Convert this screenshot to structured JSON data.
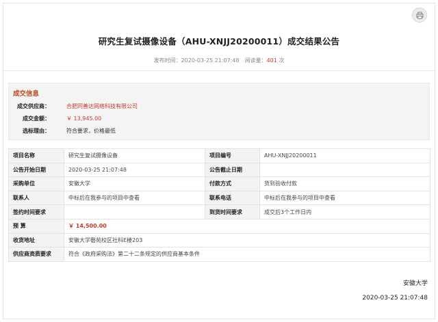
{
  "header": {
    "title": "研究生复试摄像设备（AHU-XNJJ20200011）成交结果公告",
    "publish_label": "发布时间：",
    "publish_time": "2020-03-25 21:07:48",
    "views_label": "阅读量：",
    "views_count": "401",
    "views_unit": "次"
  },
  "result_info": {
    "section_title": "成交信息",
    "rows": [
      {
        "label": "成交供应商：",
        "value": "合肥同善达网络科技有限公司"
      },
      {
        "label": "成交金额：",
        "value": "￥ 13,945.00"
      },
      {
        "label": "选标理由：",
        "value": "符合要求，价格最低"
      }
    ]
  },
  "detail_table": {
    "rows": [
      {
        "k1": "项目名称",
        "v1": "研究生复试摄像设备",
        "k2": "项目编号",
        "v2": "AHU-XNJJ20200011"
      },
      {
        "k1": "公告开始日期",
        "v1": "2020-03-25 21:07:48",
        "k2": "公告截止日期",
        "v2": ""
      },
      {
        "k1": "采购单位",
        "v1": "安徽大学",
        "k2": "付款方式",
        "v2": "货到验收付款"
      },
      {
        "k1": "联系人",
        "v1": "中标后在我参与的项目中查看",
        "k2": "联系电话",
        "v2": "中标后在我参与的项目中查看"
      },
      {
        "k1": "签约时间要求",
        "v1": "",
        "k2": "到货时间要求",
        "v2": "成交后3个工作日内"
      }
    ],
    "budget_label": "预 算",
    "budget_value": "￥ 14,500.00",
    "delivery_label": "收货地址",
    "delivery_value": "安徽大学磬苑校区社科E楼203",
    "qualification_label": "供应商资质要求",
    "qualification_value": "符合《政府采购法》第二十二条规定的供应商基本条件"
  },
  "signature": {
    "organization": "安徽大学",
    "date": "2020-03-25 21:07:48"
  },
  "icons": {
    "print": "print-icon"
  },
  "colors": {
    "accent_red": "#c0392b",
    "section_title": "#b8491f"
  }
}
